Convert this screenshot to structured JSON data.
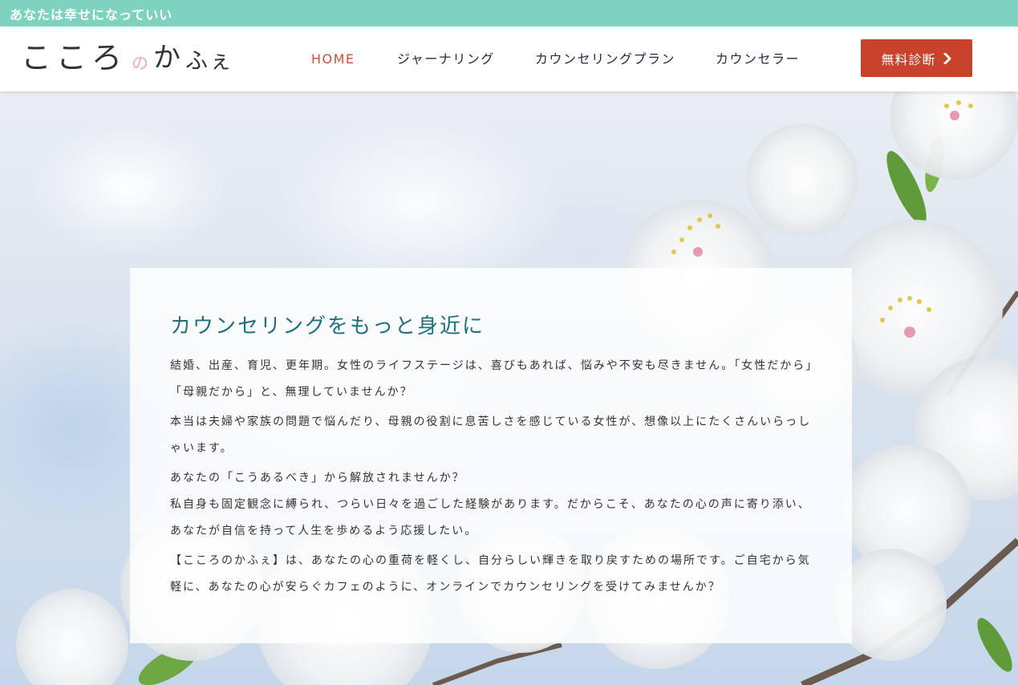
{
  "topbar": {
    "tagline": "あなたは幸せになっていい"
  },
  "header": {
    "logo": {
      "part1": "こころ",
      "connector": "の",
      "part2": "かふぇ"
    },
    "nav": [
      {
        "label": "HOME",
        "active": true
      },
      {
        "label": "ジャーナリング",
        "active": false
      },
      {
        "label": "カウンセリングプラン",
        "active": false
      },
      {
        "label": "カウンセラー",
        "active": false
      }
    ],
    "cta": {
      "label": "無料診断",
      "icon": "chevron-right-icon"
    }
  },
  "hero": {
    "heading": "カウンセリングをもっと身近に",
    "paragraphs": [
      "結婚、出産、育児、更年期。女性のライフステージは、喜びもあれば、悩みや不安も尽きません。「女性だから」「母親だから」と、無理していませんか？",
      "本当は夫婦や家族の問題で悩んだり、母親の役割に息苦しさを感じている女性が、想像以上にたくさんいらっしゃいます。",
      "あなたの「こうあるべき」から解放されませんか？\n私自身も固定観念に縛られ、つらい日々を過ごした経験があります。だからこそ、あなたの心の声に寄り添い、あなたが自信を持って人生を歩めるよう応援したい。",
      "【こころのかふぇ】は、あなたの心の重荷を軽くし、自分らしい輝きを取り戻すための場所です。ご自宅から気軽に、あなたの心が安らぐカフェのように、オンラインでカウンセリングを受けてみませんか？"
    ]
  },
  "colors": {
    "topbar": "#7dd3bd",
    "nav_active": "#c9523a",
    "cta": "#c9422c",
    "heading": "#1f6f7f",
    "logo_accent": "#f4a6bf"
  }
}
